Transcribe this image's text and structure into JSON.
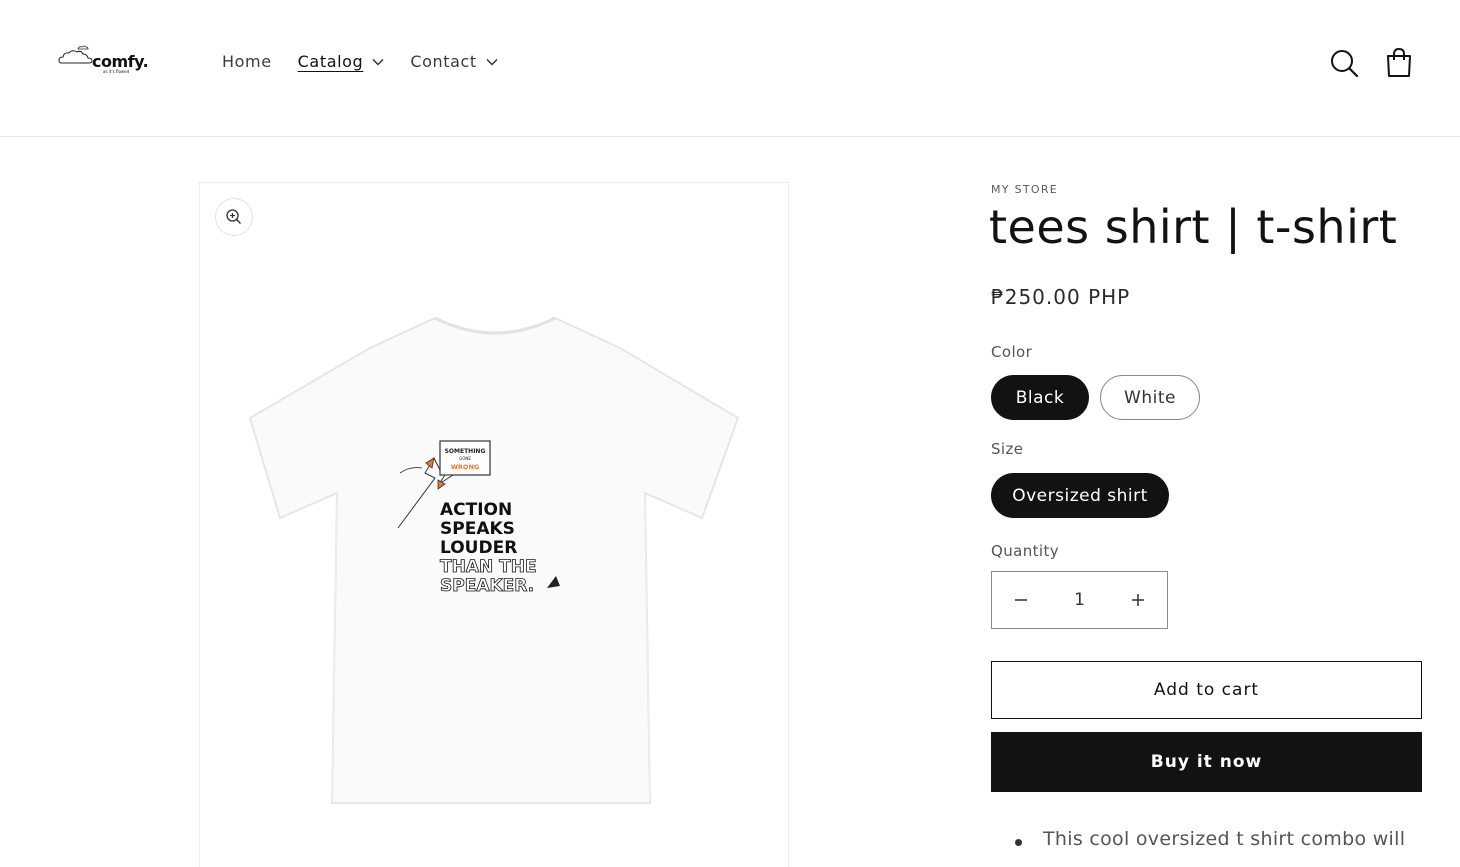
{
  "header": {
    "logo": {
      "text": "comfy.",
      "tagline": "as it's flowed"
    },
    "nav": [
      {
        "label": "Home",
        "has_dropdown": false,
        "active": false
      },
      {
        "label": "Catalog",
        "has_dropdown": true,
        "active": true
      },
      {
        "label": "Contact",
        "has_dropdown": true,
        "active": false
      }
    ],
    "icons": {
      "search": "search-icon",
      "cart": "cart-icon"
    }
  },
  "product": {
    "vendor": "MY STORE",
    "title": "tees shirt | t-shirt",
    "price": "₱250.00 PHP",
    "options": {
      "color": {
        "label": "Color",
        "values": [
          "Black",
          "White"
        ],
        "selected": "Black"
      },
      "size": {
        "label": "Size",
        "values": [
          "Oversized shirt"
        ],
        "selected": "Oversized shirt"
      }
    },
    "quantity": {
      "label": "Quantity",
      "value": "1"
    },
    "add_to_cart_label": "Add to cart",
    "buy_now_label": "Buy it now",
    "description_first_line": "This cool oversized t shirt combo will"
  },
  "media": {
    "zoom_icon": "zoom-in-icon",
    "print": {
      "bubble_line1": "SOMETHING",
      "bubble_line2": "GONE",
      "bubble_line3": "WRONG",
      "slogan": [
        "ACTION",
        "SPEAKS",
        "LOUDER",
        "THAN THE",
        "SPEAKER."
      ]
    }
  },
  "colors": {
    "primary": "#121212",
    "border": "#8a8a8a",
    "accent_print": "#e8772e"
  }
}
